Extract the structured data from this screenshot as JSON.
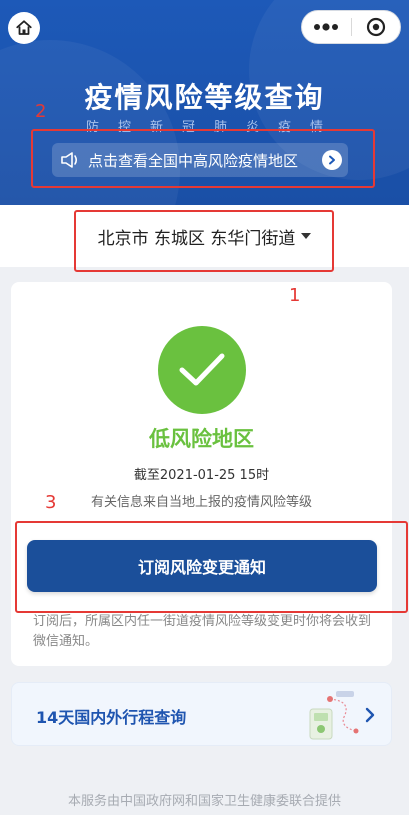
{
  "header": {
    "title": "疫情风险等级查询",
    "subtitle": "防控新冠肺炎疫情",
    "notice": "点击查看全国中高风险疫情地区",
    "home_icon": "home-icon",
    "menu_icon": "more-dots-icon",
    "close_icon": "target-icon"
  },
  "location": {
    "text": "北京市 东城区 东华门街道"
  },
  "result": {
    "risk_level": "低风险地区",
    "as_of": "截至2021-01-25 15时",
    "source_note": "有关信息来自当地上报的疫情风险等级",
    "subscribe_button": "订阅风险变更通知",
    "subscribe_note": "订阅后，所属区内任一街道疫情风险等级变更时你将会收到微信通知。"
  },
  "trip": {
    "label": "14天国内外行程查询"
  },
  "footer": {
    "text": "本服务由中国政府网和国家卫生健康委联合提供"
  },
  "annotations": {
    "one": "1",
    "two": "2",
    "three": "3"
  },
  "colors": {
    "header_blue": "#1d59b8",
    "button_blue": "#1b4f9a",
    "low_risk_green": "#6ac13f",
    "annotation_red": "#e53935"
  }
}
